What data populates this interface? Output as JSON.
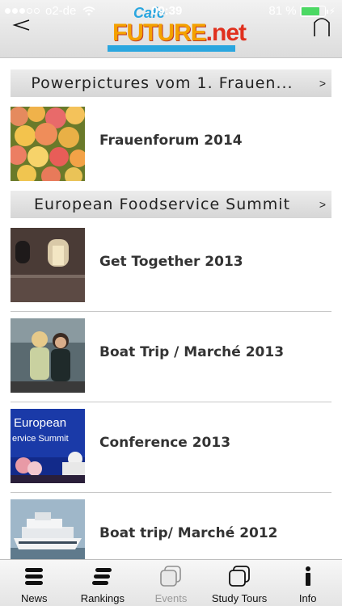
{
  "status_bar": {
    "carrier": "o2-de",
    "time": "09:39",
    "battery_percent": "81 %",
    "battery_level": 0.81
  },
  "nav": {
    "back_glyph": "<",
    "logo_top": "Cafe",
    "logo_main": "FUTURE",
    "logo_suffix": ".net",
    "icons": {
      "back": "back-arrow-icon",
      "home": "home-icon"
    }
  },
  "sections": [
    {
      "title": "Powerpictures vom 1. Frauen...",
      "chevron": ">",
      "items": [
        {
          "label": "Frauenforum 2014",
          "thumb": "flowers"
        }
      ]
    },
    {
      "title": "European Foodservice Summit",
      "chevron": ">",
      "items": [
        {
          "label": "Get Together 2013",
          "thumb": "building"
        },
        {
          "label": "Boat Trip / Marché 2013",
          "thumb": "women"
        },
        {
          "label": "Conference 2013",
          "thumb": "conference",
          "thumb_text": [
            "European",
            "ervice Summit"
          ]
        },
        {
          "label": "Boat trip/ Marché 2012",
          "thumb": "ship"
        }
      ]
    }
  ],
  "tabbar": [
    {
      "label": "News",
      "icon": "news-icon",
      "enabled": true
    },
    {
      "label": "Rankings",
      "icon": "rankings-icon",
      "enabled": true
    },
    {
      "label": "Events",
      "icon": "events-icon",
      "enabled": false
    },
    {
      "label": "Study Tours",
      "icon": "study-tours-icon",
      "enabled": true
    },
    {
      "label": "Info",
      "icon": "info-icon",
      "enabled": true
    }
  ],
  "colors": {
    "accent_blue": "#2aa6df",
    "logo_orange": "#f4a100",
    "logo_red": "#e0301e",
    "battery_green": "#4cd964"
  }
}
